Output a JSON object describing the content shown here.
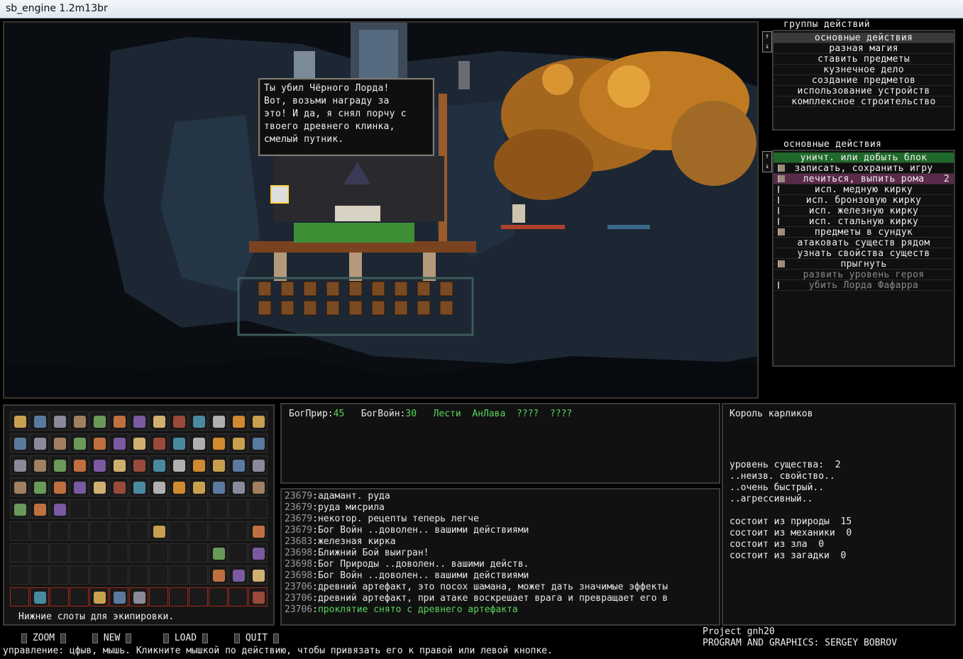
{
  "window": {
    "title": "sb_engine 1.2m13br"
  },
  "dialog": {
    "text": "Ты убил Чёрного Лорда!\nВот, возьми награду за\nэто! И да, я снял порчу с\nтвоего древнего клинка,\nсмелый путник."
  },
  "action_groups": {
    "title": "группы действий",
    "items": [
      "основные действия",
      "разная магия",
      "ставить предметы",
      "кузнечное дело",
      "создание предметов",
      "использование устройств",
      "комплексное строительство"
    ]
  },
  "basic_actions": {
    "title": "основные действия",
    "items": [
      {
        "label": "уничт. или добыть блок",
        "count": "",
        "icon": "",
        "state": "active"
      },
      {
        "label": "записать, сохранить игру",
        "count": "",
        "icon": "save-icon",
        "state": "normal"
      },
      {
        "label": "лечиться, выпить рома",
        "count": "2",
        "icon": "rum-icon",
        "state": "selected"
      },
      {
        "label": "исп. медную кирку",
        "count": "",
        "icon": "pickaxe-icon",
        "state": "normal"
      },
      {
        "label": "исп. бронзовую кирку",
        "count": "",
        "icon": "pickaxe-icon",
        "state": "normal"
      },
      {
        "label": "исп. железную кирку",
        "count": "",
        "icon": "pickaxe-icon",
        "state": "normal"
      },
      {
        "label": "исп. стальную кирку",
        "count": "",
        "icon": "pickaxe-icon",
        "state": "normal"
      },
      {
        "label": "предметы в сундук",
        "count": "",
        "icon": "chest-icon",
        "state": "normal"
      },
      {
        "label": "атаковать существ рядом",
        "count": "",
        "icon": "",
        "state": "normal"
      },
      {
        "label": "узнать свойства существ",
        "count": "",
        "icon": "",
        "state": "normal"
      },
      {
        "label": "прыгнуть",
        "count": "",
        "icon": "boot-icon",
        "state": "normal"
      },
      {
        "label": "развить уровень героя",
        "count": "",
        "icon": "",
        "state": "disabled"
      },
      {
        "label": "убить Лорда Фафарра",
        "count": "",
        "icon": "sword-icon",
        "state": "disabled"
      }
    ]
  },
  "inventory": {
    "caption": "Нижние слоты для экипировки."
  },
  "gods": {
    "nature_label": "БогПрир:",
    "nature_value": "45",
    "war_label": "БогВойн:",
    "war_value": "30",
    "lesti": "Лести",
    "anlava": "АнЛава",
    "q1": "????",
    "q2": "????"
  },
  "log": [
    {
      "num": "23679",
      "text": "адамант. руда",
      "color": "#e8e8e8"
    },
    {
      "num": "23679",
      "text": "руда мисрила",
      "color": "#e8e8e8"
    },
    {
      "num": "23679",
      "text": "некотор. рецепты теперь легче",
      "color": "#e8e8e8"
    },
    {
      "num": "23679",
      "text": "Бог Войн ..доволен.. вашими действиями",
      "color": "#e8e8e8"
    },
    {
      "num": "23683",
      "text": "железная кирка",
      "color": "#e8e8e8"
    },
    {
      "num": "23698",
      "text": "Ближний Бой выигран!",
      "color": "#e8e8e8"
    },
    {
      "num": "23698",
      "text": "Бог Природы ..доволен.. вашими действ.",
      "color": "#e8e8e8"
    },
    {
      "num": "23698",
      "text": "Бог Войн ..доволен.. вашими действиями",
      "color": "#e8e8e8"
    },
    {
      "num": "23706",
      "text": "древний артефакт, это посох шамана, может дать значимые эффекты",
      "color": "#e8e8e8"
    },
    {
      "num": "23706",
      "text": "древний артефакт, при атаке воскрешает врага и превращает его в",
      "color": "#e8e8e8"
    },
    {
      "num": "23706",
      "text": "проклятие снято с древнего артефакта",
      "color": "#57d65a"
    }
  ],
  "creature": {
    "name": "Король карликов",
    "level_label": "уровень существа:",
    "level": "2",
    "traits": [
      "..неизв. свойство..",
      "..очень быстрый..",
      "..агрессивный.."
    ],
    "stats": [
      {
        "label": "состоит из природы",
        "value": "15"
      },
      {
        "label": "состоит из механики",
        "value": "0"
      },
      {
        "label": "состоит из зла",
        "value": "0"
      },
      {
        "label": "состоит из загадки",
        "value": "0"
      }
    ]
  },
  "buttons": {
    "zoom": "ZOOM",
    "new": "NEW",
    "load": "LOAD",
    "quit": "QUIT"
  },
  "credits": {
    "project": "Project gnh20",
    "author": "PROGRAM AND GRAPHICS: SERGEY BOBROV"
  },
  "hint": "управление: цфыв, мышь. Кликните мышкой по действию, чтобы привязать его к правой или левой кнопке."
}
